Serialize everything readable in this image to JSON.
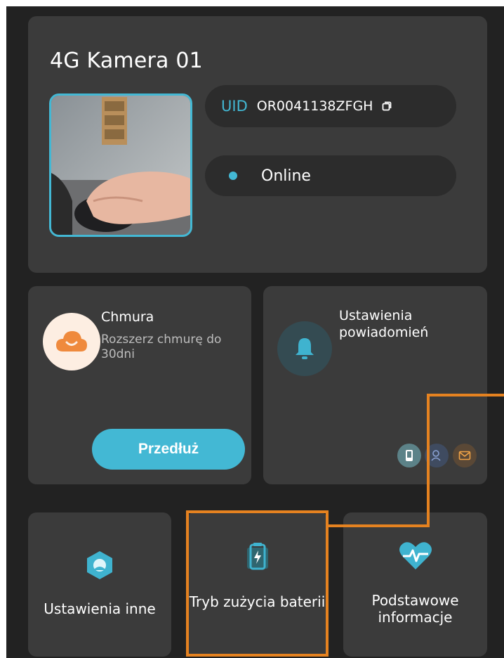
{
  "device": {
    "title": "4G Kamera 01",
    "uid_label": "UID",
    "uid_value": "OR0041138ZFGH",
    "status": "Online"
  },
  "cloud": {
    "title": "Chmura",
    "subtitle": "Rozszerz chmurę do 30dni",
    "button": "Przedłuż"
  },
  "notifications": {
    "title": "Ustawienia powiadomień",
    "channel_icons": [
      "phone-icon",
      "user-icon",
      "mail-icon"
    ]
  },
  "tiles": [
    {
      "label": "Ustawienia inne",
      "icon": "hex-settings-icon"
    },
    {
      "label": "Tryb zużycia baterii",
      "icon": "battery-mode-icon"
    },
    {
      "label": "Podstawowe informacje",
      "icon": "heart-pulse-icon"
    }
  ],
  "colors": {
    "background": "#222222",
    "card": "#3b3b3b",
    "accent": "#43b8d4",
    "highlight": "#e58220"
  }
}
